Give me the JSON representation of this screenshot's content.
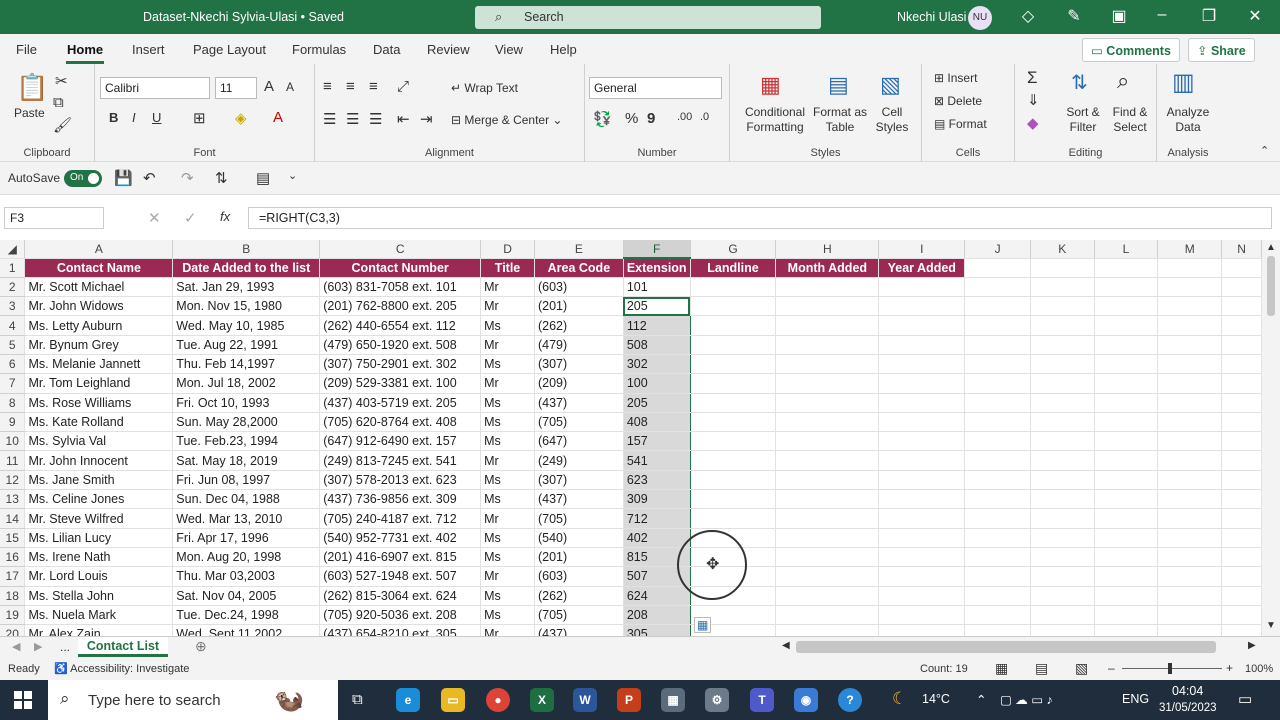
{
  "titlebar": {
    "doc_title": "Dataset-Nkechi Sylvia-Ulasi • Saved",
    "search_placeholder": "Search",
    "user_name": "Nkechi Ulasi",
    "user_initials": "NU"
  },
  "menu": {
    "tabs": [
      "File",
      "Home",
      "Insert",
      "Page Layout",
      "Formulas",
      "Data",
      "Review",
      "View",
      "Help"
    ],
    "active_tab": "Home",
    "comments_label": "Comments",
    "share_label": "Share"
  },
  "ribbon": {
    "clipboard": {
      "paste": "Paste",
      "group": "Clipboard"
    },
    "font": {
      "font_name": "Calibri",
      "font_size": "11",
      "group": "Font"
    },
    "alignment": {
      "wrap_text": "Wrap Text",
      "merge_center": "Merge & Center",
      "group": "Alignment"
    },
    "number": {
      "format": "General",
      "group": "Number"
    },
    "styles": {
      "conditional": "Conditional Formatting",
      "format_table": "Format as Table",
      "cell_styles": "Cell Styles",
      "group": "Styles"
    },
    "cells": {
      "insert": "Insert",
      "delete": "Delete",
      "format": "Format",
      "group": "Cells"
    },
    "editing": {
      "sort_filter": "Sort & Filter",
      "find_select": "Find & Select",
      "group": "Editing"
    },
    "analysis": {
      "analyze": "Analyze Data",
      "group": "Analysis"
    }
  },
  "qat": {
    "autosave_label": "AutoSave",
    "autosave_state": "On"
  },
  "formula_bar": {
    "name_box": "F3",
    "fx": "fx",
    "formula": "=RIGHT(C3,3)"
  },
  "columns": [
    "A",
    "B",
    "C",
    "D",
    "E",
    "F",
    "G",
    "H",
    "I",
    "J",
    "K",
    "L",
    "M",
    "N"
  ],
  "headers": [
    "Contact Name",
    "Date Added to the list",
    "Contact Number",
    "Title",
    "Area Code",
    "Extension",
    "Landline",
    "Month Added",
    "Year Added"
  ],
  "rows": [
    [
      "Mr. Scott Michael",
      "Sat. Jan 29, 1993",
      "(603) 831-7058 ext. 101",
      "Mr",
      "(603)",
      "101"
    ],
    [
      "Mr. John Widows",
      "Mon. Nov 15, 1980",
      "(201) 762-8800 ext. 205",
      "Mr",
      "(201)",
      "205"
    ],
    [
      "Ms. Letty Auburn",
      "Wed. May 10, 1985",
      "(262) 440-6554 ext. 112",
      "Ms",
      "(262)",
      "112"
    ],
    [
      "Mr. Bynum Grey",
      "Tue. Aug 22, 1991",
      "(479) 650-1920 ext. 508",
      "Mr",
      "(479)",
      "508"
    ],
    [
      "Ms. Melanie Jannett",
      "Thu. Feb 14,1997",
      "(307) 750-2901 ext. 302",
      "Ms",
      "(307)",
      "302"
    ],
    [
      "Mr. Tom Leighland",
      "Mon. Jul 18, 2002",
      "(209) 529-3381 ext. 100",
      "Mr",
      "(209)",
      "100"
    ],
    [
      "Ms. Rose Williams",
      "Fri. Oct 10, 1993",
      "(437) 403-5719 ext. 205",
      "Ms",
      "(437)",
      "205"
    ],
    [
      "Ms. Kate Rolland",
      "Sun. May 28,2000",
      "(705) 620-8764 ext. 408",
      "Ms",
      "(705)",
      "408"
    ],
    [
      "Ms. Sylvia Val",
      "Tue. Feb.23, 1994",
      "(647) 912-6490 ext. 157",
      "Ms",
      "(647)",
      "157"
    ],
    [
      "Mr. John Innocent",
      "Sat. May 18, 2019",
      "(249) 813-7245 ext. 541",
      "Mr",
      "(249)",
      "541"
    ],
    [
      "Ms. Jane Smith",
      "Fri. Jun 08, 1997",
      "(307) 578-2013 ext. 623",
      "Ms",
      "(307)",
      "623"
    ],
    [
      "Ms. Celine Jones",
      "Sun. Dec 04, 1988",
      "(437) 736-9856 ext. 309",
      "Ms",
      "(437)",
      "309"
    ],
    [
      "Mr. Steve Wilfred",
      "Wed. Mar 13, 2010",
      "(705) 240-4187 ext. 712",
      "Mr",
      "(705)",
      "712"
    ],
    [
      "Ms. Lilian Lucy",
      "Fri. Apr 17, 1996",
      "(540) 952-7731 ext. 402",
      "Ms",
      "(540)",
      "402"
    ],
    [
      "Ms. Irene Nath",
      "Mon. Aug 20, 1998",
      "(201) 416-6907 ext. 815",
      "Ms",
      "(201)",
      "815"
    ],
    [
      "Mr. Lord Louis",
      "Thu. Mar 03,2003",
      "(603) 527-1948 ext. 507",
      "Mr",
      "(603)",
      "507"
    ],
    [
      "Ms. Stella John",
      "Sat. Nov 04, 2005",
      "(262) 815-3064 ext. 624",
      "Ms",
      "(262)",
      "624"
    ],
    [
      "Ms. Nuela Mark",
      "Tue. Dec.24, 1998",
      "(705) 920-5036 ext. 208",
      "Ms",
      "(705)",
      "208"
    ],
    [
      "Mr. Alex Zain",
      "Wed. Sept 11,2002",
      "(437) 654-8210 ext. 305",
      "Mr",
      "(437)",
      "305"
    ]
  ],
  "sheet": {
    "ellipsis": "...",
    "tab_name": "Contact List"
  },
  "status": {
    "ready": "Ready",
    "accessibility": "Accessibility: Investigate",
    "count": "Count: 19",
    "zoom": "100%"
  },
  "taskbar": {
    "search_placeholder": "Type here to search",
    "weather": "14°C",
    "lang": "ENG",
    "time": "04:04",
    "date": "31/05/2023"
  },
  "colors": {
    "excel_green": "#217346",
    "header_fill": "#9a2a54"
  }
}
